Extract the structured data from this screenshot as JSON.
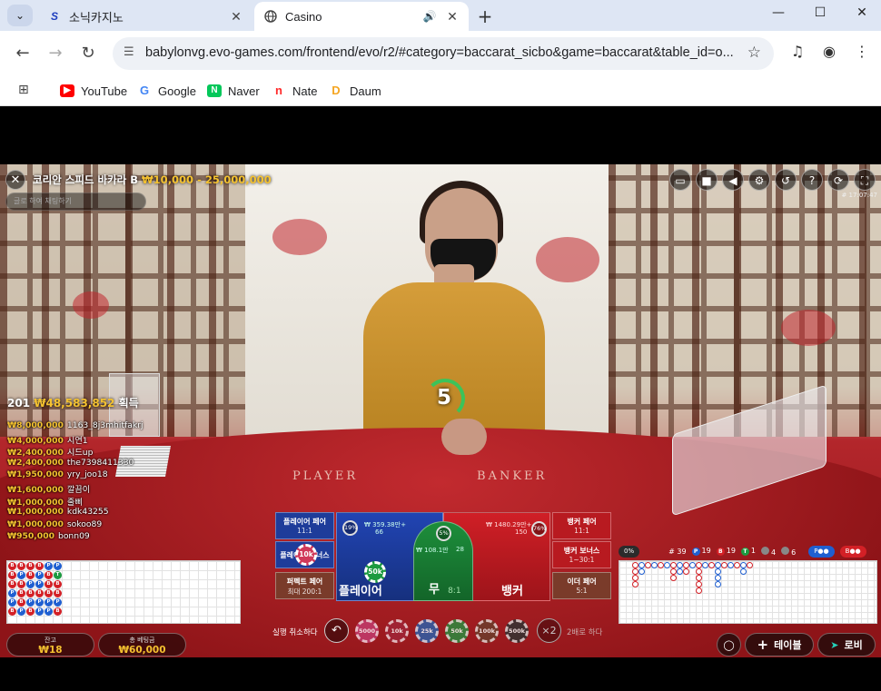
{
  "browser": {
    "tabs": [
      {
        "title": "소닉카지노",
        "favicon": "S",
        "active": false
      },
      {
        "title": "Casino",
        "favicon": "globe-icon",
        "active": true
      }
    ],
    "url": "babylonvg.evo-games.com/frontend/evo/r2/#category=baccarat_sicbo&game=baccarat&table_id=o...",
    "bookmarks": [
      {
        "label": "YouTube",
        "icon": "youtube-icon",
        "color": "#ff0000"
      },
      {
        "label": "Google",
        "icon": "google-icon",
        "color": "#4285f4"
      },
      {
        "label": "Naver",
        "icon": "naver-icon",
        "color": "#03c75a"
      },
      {
        "label": "Nate",
        "icon": "nate-icon",
        "color": "#ff2a2a"
      },
      {
        "label": "Daum",
        "icon": "daum-icon",
        "color": "#f5a623"
      }
    ]
  },
  "game": {
    "table_name": "코리안 스피드 바카라 B",
    "limits": "₩10,000 - 25,000,000",
    "chat_placeholder": "글로 하여 채팅하기",
    "timestamp": "# 17:07:47",
    "countdown": "5",
    "table_labels": {
      "player": "PLAYER",
      "banker": "BANKER"
    },
    "winners_header": {
      "count": "201",
      "amount": "₩48,583,852",
      "suffix": "획득"
    },
    "winners": [
      {
        "amount": "₩8,000,000",
        "user": "1163_8j3mhitfakrj"
      },
      {
        "amount": "₩4,000,000",
        "user": "시연1"
      },
      {
        "amount": "₩2,400,000",
        "user": "시드up"
      },
      {
        "amount": "₩2,400,000",
        "user": "the7398411330"
      },
      {
        "amount": "₩1,950,000",
        "user": "yry_joo18"
      },
      {
        "amount": "₩1,600,000",
        "user": "깔끔이"
      },
      {
        "amount": "₩1,000,000",
        "user": "줄삐"
      },
      {
        "amount": "₩1,000,000",
        "user": "kdk43255"
      },
      {
        "amount": "₩1,000,000",
        "user": "sokoo89"
      },
      {
        "amount": "₩950,000",
        "user": "bonn09"
      }
    ],
    "bets": {
      "player_pair": {
        "label": "플레이어 페어",
        "odds": "11:1"
      },
      "player_bonus": {
        "label": "플레이어 보너스"
      },
      "perfect_pair": {
        "label": "퍼펙트 페어",
        "odds": "최대 200:1"
      },
      "player": {
        "label": "플레이어",
        "stake": "₩ 359.38만+",
        "count": "66",
        "pct": "19%"
      },
      "tie": {
        "label": "무",
        "odds": "8:1",
        "stake": "₩ 108.1만",
        "count": "28",
        "pct": "5%"
      },
      "banker": {
        "label": "뱅커",
        "stake": "₩ 1480.29만+",
        "count": "150",
        "pct": "76%"
      },
      "banker_pair": {
        "label": "뱅커 페어",
        "odds": "11:1"
      },
      "banker_bonus": {
        "label": "뱅커 보너스",
        "odds": "1~30:1"
      },
      "either_pair": {
        "label": "이더 페어",
        "odds": "5:1"
      }
    },
    "placed_chips": [
      {
        "label": "10k",
        "color": "#d0395a"
      },
      {
        "label": "50k",
        "color": "#1c9a40"
      }
    ],
    "road_stats": {
      "pct": "0%",
      "rounds": "# 39",
      "player": "19",
      "banker": "19",
      "tie": "1",
      "player_pairs": "4",
      "banker_pairs": "6"
    },
    "bead_road": [
      [
        "B",
        "B",
        "B",
        "B",
        "P",
        "P"
      ],
      [
        "B",
        "P",
        "B",
        "P",
        "B",
        "T"
      ],
      [
        "B",
        "B",
        "P",
        "P",
        "B",
        "B"
      ],
      [
        "P",
        "B",
        "B",
        "B",
        "B",
        "B"
      ],
      [
        "P",
        "B",
        "P",
        "P",
        "P",
        "P"
      ],
      [
        "B",
        "P",
        "B",
        "P",
        "P",
        "B"
      ]
    ],
    "balance": {
      "label": "잔고",
      "value": "₩18"
    },
    "total_bet": {
      "label": "총 베팅금",
      "value": "₩60,000"
    },
    "undo_label": "실행 취소하다",
    "double_label": "2배로 하다",
    "double_symbol": "×2",
    "chips": [
      "5000",
      "10k",
      "25k",
      "50k",
      "100k",
      "500k"
    ],
    "chip_colors": [
      "#c23b6d",
      "#a02537",
      "#2d5fa8",
      "#2b8a3e",
      "#6d3d2b",
      "#333333"
    ],
    "buttons": {
      "table": "테이블",
      "lobby": "로비"
    }
  }
}
